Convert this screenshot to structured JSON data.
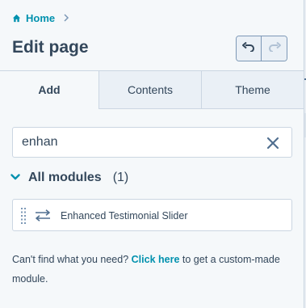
{
  "header": {
    "breadcrumb_label": "Home",
    "title": "Edit page"
  },
  "tabs": [
    {
      "label": "Add",
      "active": true
    },
    {
      "label": "Contents",
      "active": false
    },
    {
      "label": "Theme",
      "active": false
    }
  ],
  "search": {
    "value": "enhan"
  },
  "modules": {
    "title": "All modules",
    "count": "(1)",
    "items": [
      {
        "label": "Enhanced Testimonial Slider",
        "icon": "swap-arrows-icon"
      }
    ]
  },
  "help": {
    "prefix": "Can't find what you need?",
    "link": "Click here",
    "suffix": "to get a custom-made module."
  },
  "colors": {
    "link": "#0091ae",
    "text": "#33475b",
    "background": "#f5f8fa",
    "border": "#cbd6e2"
  }
}
